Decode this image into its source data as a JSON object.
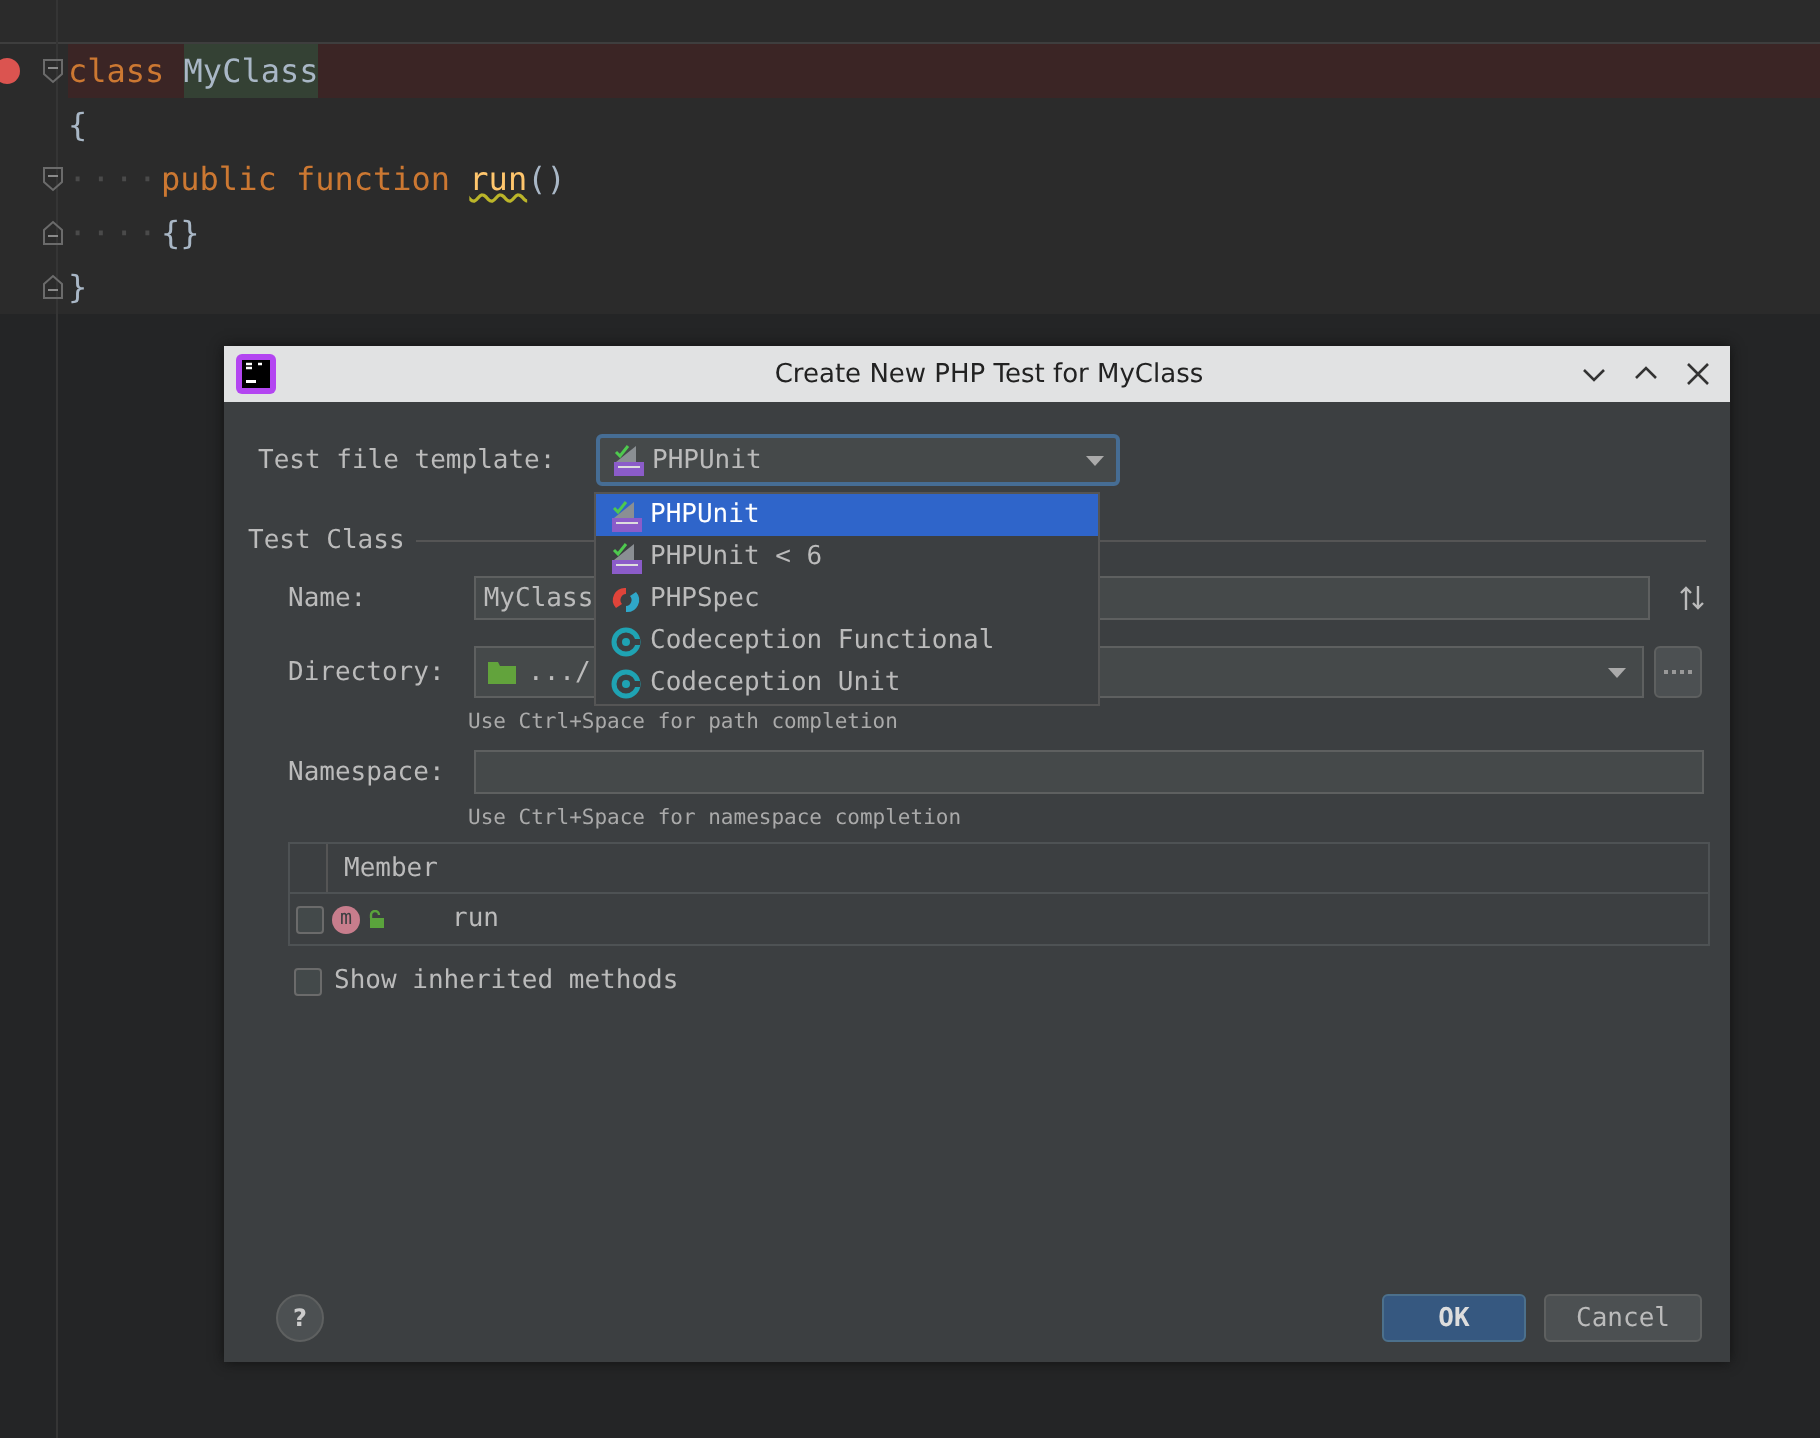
{
  "editor": {
    "lines": [
      {
        "breakpoint": true,
        "highlighted": true,
        "kind": "fold-start",
        "tokens": [
          {
            "kind": "keyword",
            "text": "class "
          },
          {
            "kind": "class-name",
            "text": "MyClass"
          }
        ]
      },
      {
        "breakpoint": false,
        "highlighted": false,
        "kind": "plain",
        "tokens": [
          {
            "kind": "brace",
            "text": "{"
          }
        ]
      },
      {
        "breakpoint": false,
        "highlighted": false,
        "kind": "fold-start",
        "tokens": [
          {
            "kind": "whitespace",
            "text": "····"
          },
          {
            "kind": "keyword",
            "text": "public "
          },
          {
            "kind": "keyword",
            "text": "function "
          },
          {
            "kind": "warning",
            "text": "run"
          },
          {
            "kind": "brace",
            "text": "()"
          }
        ]
      },
      {
        "breakpoint": false,
        "highlighted": false,
        "kind": "fold-end",
        "tokens": [
          {
            "kind": "whitespace",
            "text": "····"
          },
          {
            "kind": "brace",
            "text": "{}"
          }
        ]
      },
      {
        "breakpoint": false,
        "highlighted": false,
        "kind": "fold-end",
        "tokens": [
          {
            "kind": "brace",
            "text": "}"
          }
        ]
      }
    ]
  },
  "dialog": {
    "title": "Create New PHP Test for MyClass",
    "template": {
      "label": "Test file template:",
      "value": "PHPUnit",
      "kind": "phpunit"
    },
    "dropdown": [
      {
        "label": "PHPUnit",
        "kind": "phpunit",
        "selected": true
      },
      {
        "label": "PHPUnit < 6",
        "kind": "phpunit",
        "selected": false
      },
      {
        "label": "PHPSpec",
        "kind": "phpspec",
        "selected": false
      },
      {
        "label": "Codeception Functional",
        "kind": "codeception",
        "selected": false
      },
      {
        "label": "Codeception Unit",
        "kind": "codeception",
        "selected": false
      }
    ],
    "section": "Test Class",
    "name": {
      "label": "Name:",
      "value": "MyClass"
    },
    "directory": {
      "label": "Directory:",
      "value": ".../",
      "hint": "Use Ctrl+Space for path completion"
    },
    "namespace": {
      "label": "Namespace:",
      "hint": "Use Ctrl+Space for namespace completion"
    },
    "members": {
      "column": "Member",
      "rows": [
        {
          "name": "run",
          "checked": false,
          "badge": "m"
        }
      ]
    },
    "show_inherited": {
      "label": "Show inherited methods",
      "checked": false
    },
    "help": "?",
    "buttons": [
      {
        "label": "OK",
        "primary": true
      },
      {
        "label": "Cancel",
        "primary": false
      }
    ]
  }
}
